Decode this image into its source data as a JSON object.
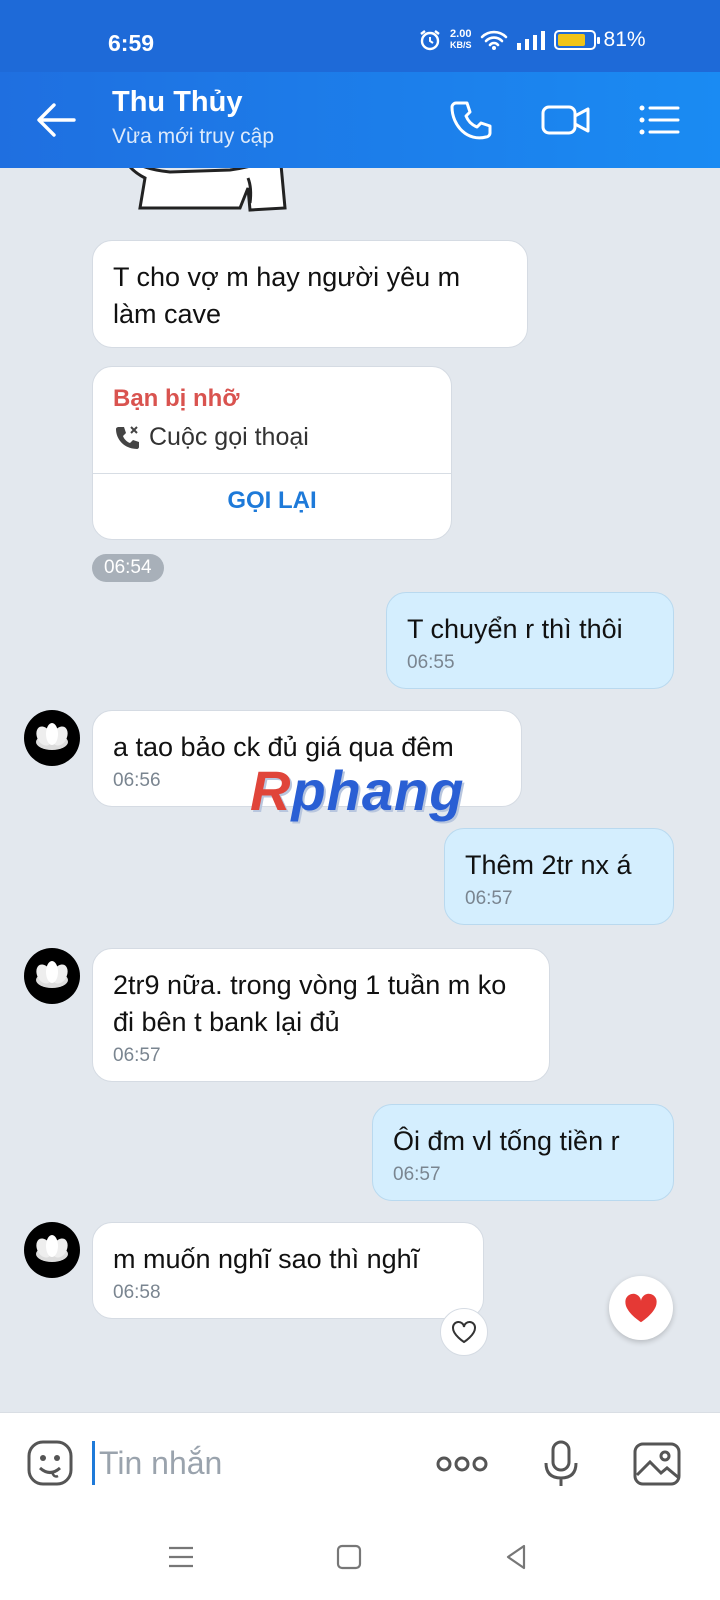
{
  "status_bar": {
    "time": "6:59",
    "net_speed_value": "2.00",
    "net_speed_unit": "KB/S",
    "battery": "81%",
    "battery_level": 0.81
  },
  "header": {
    "title": "Thu Thủy",
    "subtitle": "Vừa mới truy cập"
  },
  "messages": [
    {
      "direction": "in",
      "text": "T cho vợ m hay người yêu m làm cave",
      "time": ""
    },
    {
      "direction": "out",
      "text": "T chuyển r thì thôi",
      "time": "06:55"
    },
    {
      "direction": "in",
      "text": "a tao bảo ck đủ giá qua đêm",
      "time": "06:56"
    },
    {
      "direction": "out",
      "text": "Thêm 2tr nx á",
      "time": "06:57"
    },
    {
      "direction": "in",
      "text": "2tr9 nữa. trong vòng 1 tuần m ko đi bên t bank lại đủ",
      "time": "06:57"
    },
    {
      "direction": "out",
      "text": "Ôi đm vl tống tiền r",
      "time": "06:57"
    },
    {
      "direction": "in",
      "text": "m muốn nghĩ sao thì nghĩ",
      "time": "06:58"
    }
  ],
  "missed_call": {
    "title": "Bạn bị nhỡ",
    "label": "Cuộc gọi thoại",
    "action": "GỌI LẠI",
    "time": "06:54"
  },
  "watermark": {
    "part1": "R",
    "part2": "phang"
  },
  "input": {
    "placeholder": "Tin nhắn"
  },
  "colors": {
    "header": "#1f6fe0",
    "outgoing_bubble": "#d4eefe",
    "incoming_bubble": "#ffffff",
    "missed_title": "#d9534f",
    "link": "#1e7ad9",
    "heart": "#e53935"
  }
}
